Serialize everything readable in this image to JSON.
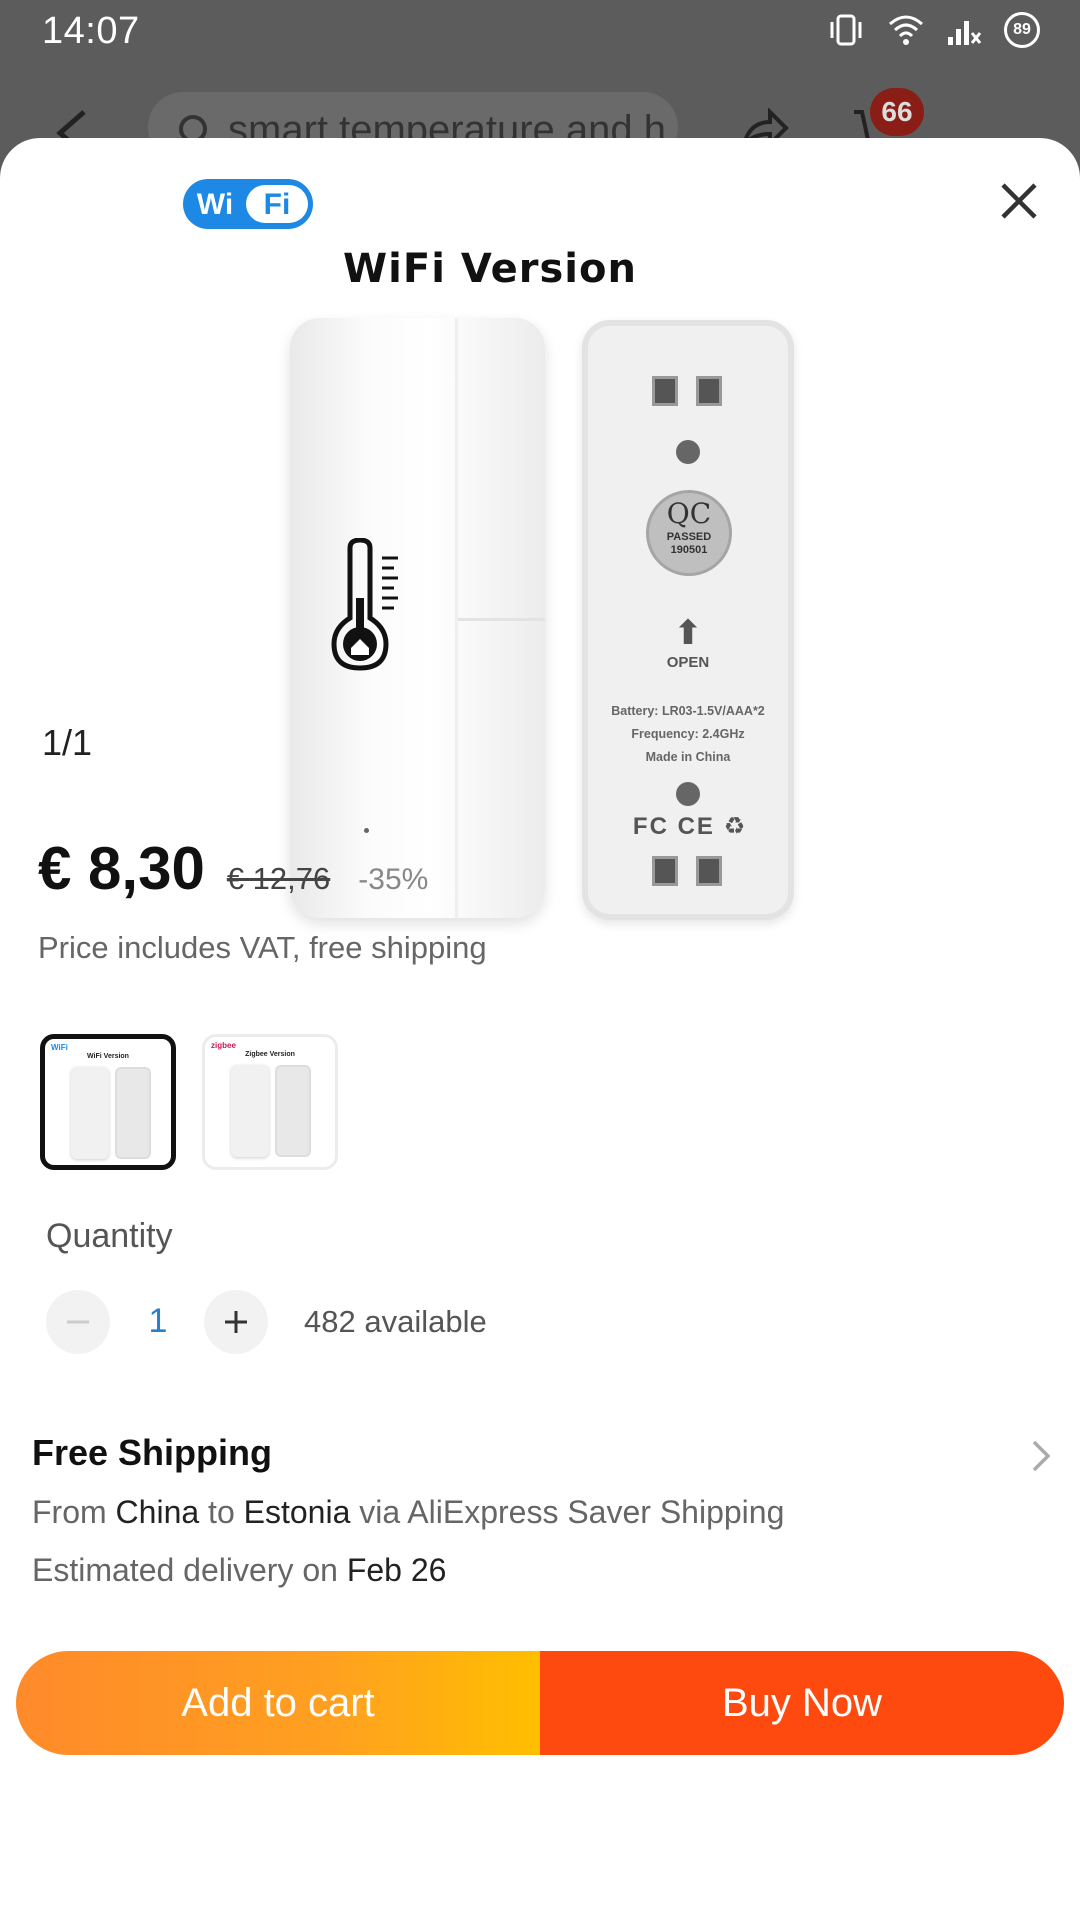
{
  "status_bar": {
    "time": "14:07",
    "battery": "89"
  },
  "background_header": {
    "search_text": "smart temperature and h",
    "cart_count": "66"
  },
  "product_image": {
    "title": "WiFi Version",
    "logo_text_a": "Wi",
    "logo_text_b": "Fi",
    "qc_text": "QC",
    "qc_passed": "PASSED",
    "qc_date": "190501",
    "open_label": "OPEN",
    "battery_line": "Battery: LR03-1.5V/AAA*2",
    "frequency_line": "Frequency: 2.4GHz",
    "made_line": "Made in China",
    "cert_marks": "FC CE",
    "counter": "1/1"
  },
  "price": {
    "current": "€ 8,30",
    "original": "€ 12,76",
    "discount": "-35%",
    "note": "Price includes VAT, free shipping"
  },
  "variants": [
    {
      "title": "WiFi Version",
      "logo": "WiFi",
      "selected": true
    },
    {
      "title": "Zigbee Version",
      "logo": "zigbee",
      "selected": false
    }
  ],
  "quantity": {
    "label": "Quantity",
    "value": "1",
    "available": "482 available"
  },
  "shipping": {
    "title": "Free Shipping",
    "from_prefix": "From ",
    "from": "China",
    "to_word": " to ",
    "to": "Estonia",
    "via": " via AliExpress Saver Shipping",
    "estimate_prefix": "Estimated delivery on ",
    "estimate_date": "Feb 26"
  },
  "actions": {
    "add_to_cart": "Add to cart",
    "buy_now": "Buy Now"
  },
  "colors": {
    "accent_orange": "#ff8a2a",
    "buy_red": "#ff4a0f",
    "wifi_blue": "#1e88e5"
  }
}
